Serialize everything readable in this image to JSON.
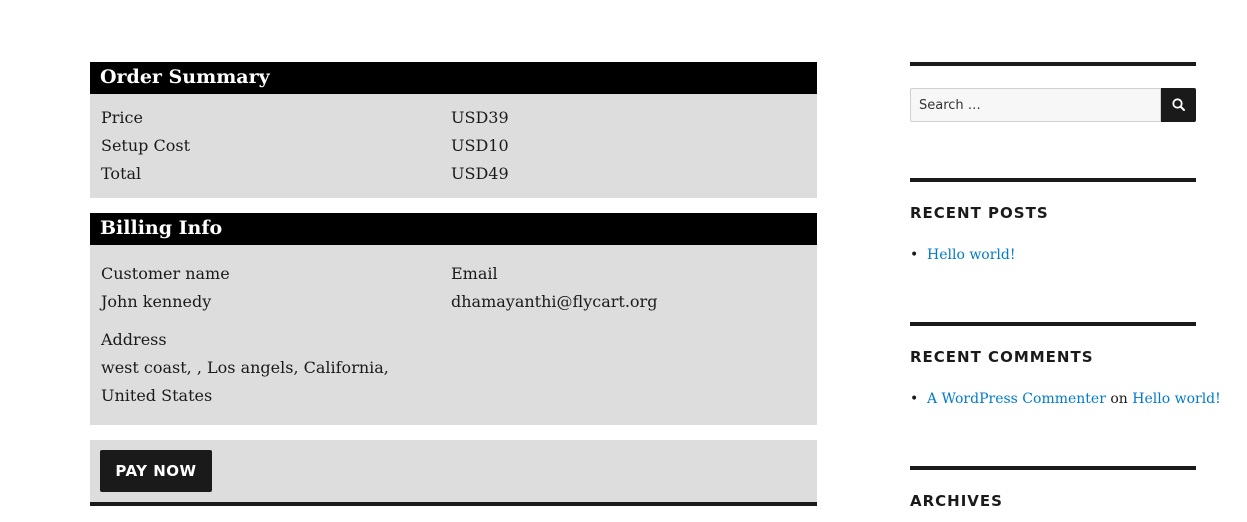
{
  "order_summary": {
    "title": "Order Summary",
    "rows": [
      {
        "label": "Price",
        "value": "USD39"
      },
      {
        "label": "Setup Cost",
        "value": "USD10"
      },
      {
        "label": "Total",
        "value": "USD49"
      }
    ]
  },
  "billing_info": {
    "title": "Billing Info",
    "customer_name_label": "Customer name",
    "customer_name": "John kennedy",
    "email_label": "Email",
    "email": "dhamayanthi@flycart.org",
    "address_label": "Address",
    "address": "west coast, , Los angels, California, United States"
  },
  "pay_button_label": "PAY NOW",
  "sidebar": {
    "search": {
      "placeholder": "Search …",
      "icon": "search-icon"
    },
    "recent_posts": {
      "title": "RECENT POSTS",
      "items": [
        {
          "link": "Hello world!"
        }
      ]
    },
    "recent_comments": {
      "title": "RECENT COMMENTS",
      "items": [
        {
          "author": "A WordPress Commenter",
          "connector": "on",
          "post": "Hello world!"
        }
      ]
    },
    "archives": {
      "title": "ARCHIVES"
    }
  },
  "colors": {
    "header_bg": "#000000",
    "panel_bg": "#dddddd",
    "button_bg": "#1a1a1a",
    "link": "#007acc"
  }
}
